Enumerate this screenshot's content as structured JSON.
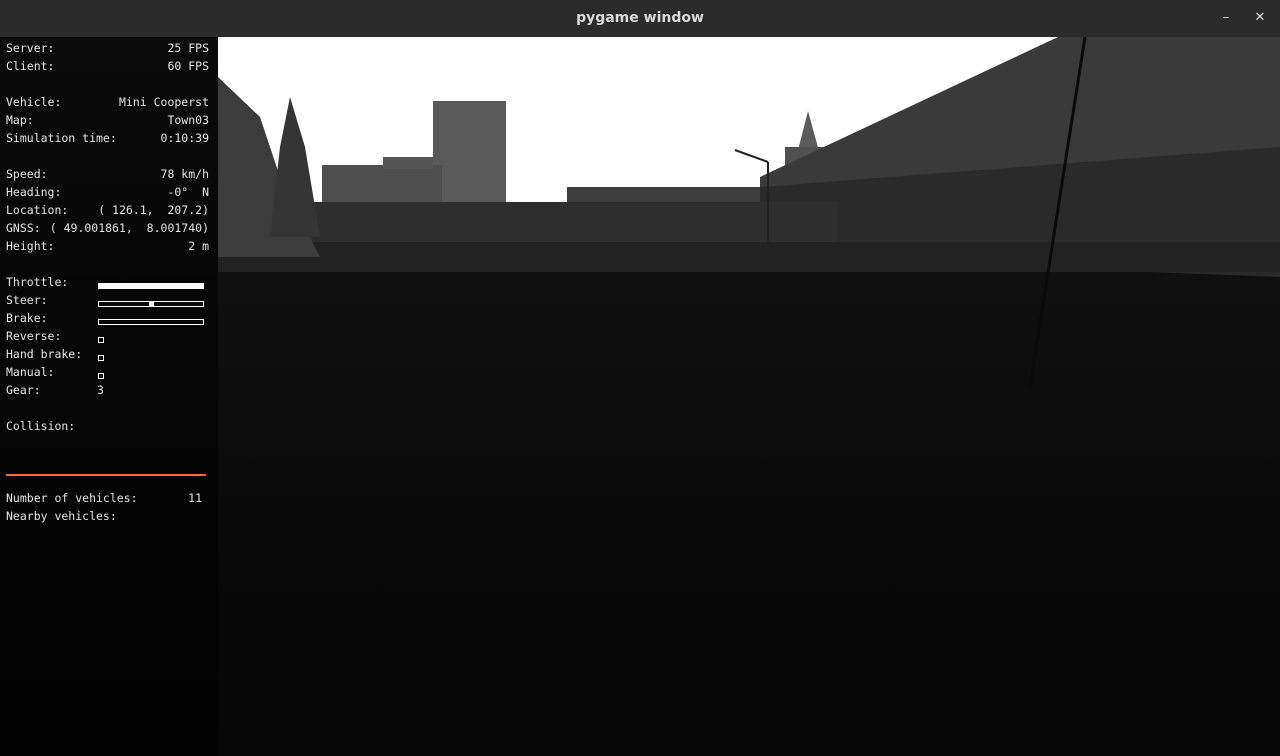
{
  "window": {
    "title": "pygame window",
    "minimize": "–",
    "close": "✕"
  },
  "hud": {
    "server": {
      "label": "Server:",
      "value": "25 FPS"
    },
    "client": {
      "label": "Client:",
      "value": "60 FPS"
    },
    "vehicle": {
      "label": "Vehicle:",
      "value": "Mini Cooperst"
    },
    "map": {
      "label": "Map:",
      "value": "Town03"
    },
    "sim_time": {
      "label": "Simulation time:",
      "value": "0:10:39"
    },
    "speed": {
      "label": "Speed:",
      "value": "78 km/h"
    },
    "heading": {
      "label": "Heading:",
      "value": "-0°  N"
    },
    "location": {
      "label": "Location:",
      "value": "( 126.1,  207.2)"
    },
    "gnss": {
      "label": "GNSS:",
      "value": "( 49.001861,  8.001740)"
    },
    "height": {
      "label": "Height:",
      "value": "2 m"
    },
    "throttle": {
      "label": "Throttle:",
      "level": 1.0
    },
    "steer": {
      "label": "Steer:",
      "level": 0.5
    },
    "brake": {
      "label": "Brake:",
      "level": 0.0
    },
    "reverse": {
      "label": "Reverse:",
      "checked": false
    },
    "hand_brake": {
      "label": "Hand brake:",
      "checked": false
    },
    "manual": {
      "label": "Manual:",
      "checked": false
    },
    "gear": {
      "label": "Gear:",
      "value": "3"
    },
    "collision": {
      "label": "Collision:"
    },
    "num_vehicles": {
      "label": "Number of vehicles:",
      "value": "11"
    },
    "nearby": {
      "label": "Nearby vehicles:"
    }
  },
  "colors": {
    "accent": "#ff6a3c",
    "titlebar": "#2b2b2b"
  }
}
